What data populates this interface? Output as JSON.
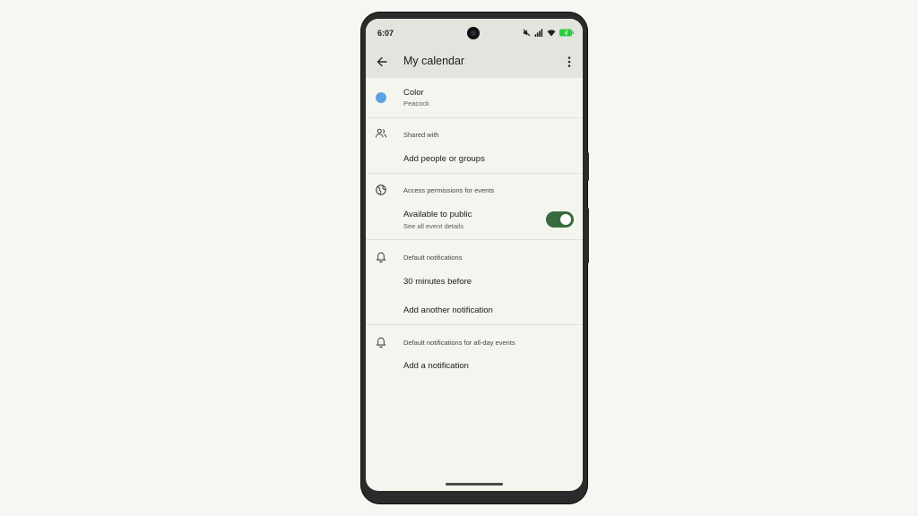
{
  "status_bar": {
    "time": "6:07"
  },
  "app_bar": {
    "title": "My calendar"
  },
  "color": {
    "label": "Color",
    "value": "Peacock",
    "swatch": "#5ba3e0"
  },
  "shared": {
    "header": "Shared with",
    "action": "Add people or groups"
  },
  "access": {
    "header": "Access permissions for events",
    "label": "Available to public",
    "sublabel": "See all event details",
    "enabled": true
  },
  "default_notifications": {
    "header": "Default notifications",
    "items": [
      "30 minutes before"
    ],
    "add": "Add another notification"
  },
  "allday_notifications": {
    "header": "Default notifications for all-day events",
    "add": "Add a notification"
  },
  "colors": {
    "toggle_on": "#386a3f",
    "battery": "#2ecc40",
    "appbar": "#e2e5dd"
  }
}
